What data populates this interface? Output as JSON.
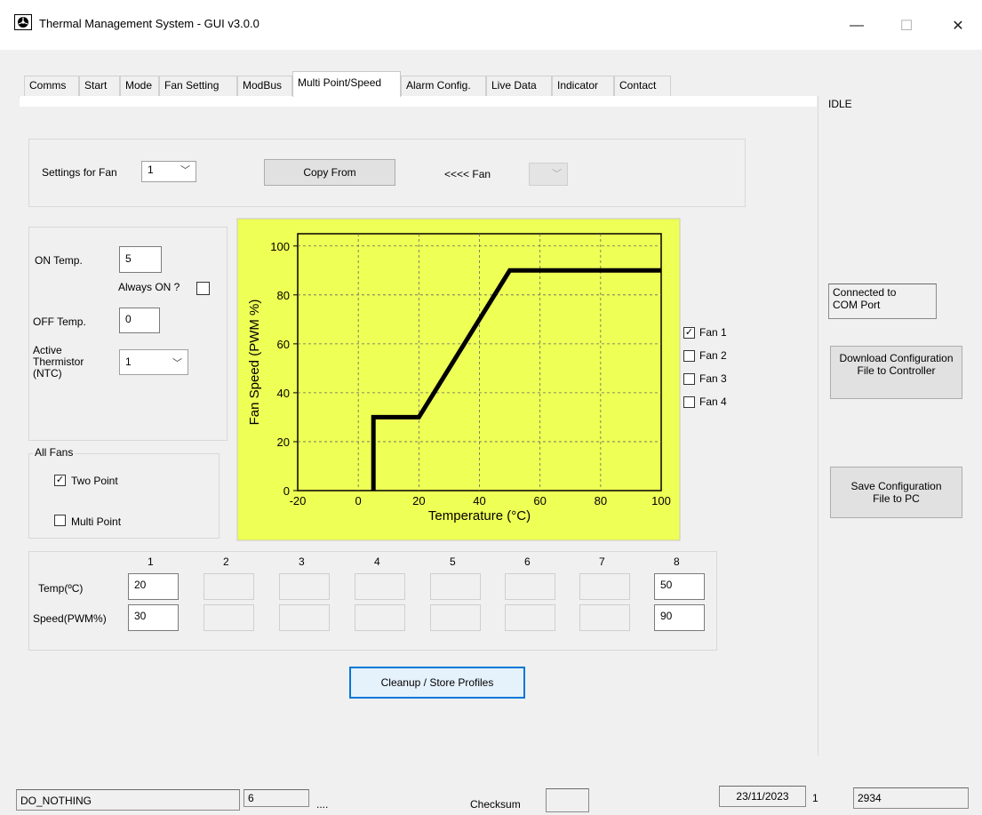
{
  "window": {
    "title": "Thermal Management System - GUI   v3.0.0",
    "minimize_glyph": "—",
    "maximize_glyph": "☐",
    "close_glyph": "✕"
  },
  "tabs": [
    "Comms",
    "Start",
    "Mode",
    "Fan Setting",
    "ModBus",
    "Multi Point/Speed",
    "Alarm Config.",
    "Live Data",
    "Indicator",
    "Contact"
  ],
  "active_tab": "Multi Point/Speed",
  "fan_select": {
    "label": "Settings for Fan",
    "value": "1",
    "copy_button": "Copy From",
    "arrow_label": "<<<<  Fan",
    "source_value": ""
  },
  "temp_settings": {
    "on_label": "ON Temp.",
    "on_value": "5",
    "always_on_label": "Always ON ?",
    "always_on_checked": false,
    "off_label": "OFF Temp.",
    "off_value": "0",
    "thermistor_label": "Active Thermistor (NTC)",
    "thermistor_value": "1"
  },
  "all_fans": {
    "title": "All Fans",
    "two_point_label": "Two Point",
    "two_point_checked": true,
    "multi_point_label": "Multi Point",
    "multi_point_checked": false
  },
  "chart_data": {
    "type": "line",
    "xlabel": "Temperature (°C)",
    "ylabel": "Fan Speed (PWM %)",
    "xlim": [
      -20,
      100
    ],
    "ylim": [
      0,
      105
    ],
    "x_ticks": [
      -20,
      0,
      20,
      40,
      60,
      80,
      100
    ],
    "y_ticks": [
      0,
      20,
      40,
      60,
      80,
      100
    ],
    "grid": true,
    "background": "#eeff55",
    "series": [
      {
        "x": [
          5,
          5,
          20,
          50,
          100
        ],
        "y": [
          0,
          30,
          30,
          90,
          90
        ]
      }
    ]
  },
  "fan_checks": [
    {
      "label": "Fan 1",
      "checked": true
    },
    {
      "label": "Fan 2",
      "checked": false
    },
    {
      "label": "Fan 3",
      "checked": false
    },
    {
      "label": "Fan 4",
      "checked": false
    }
  ],
  "points_table": {
    "columns": [
      "1",
      "2",
      "3",
      "4",
      "5",
      "6",
      "7",
      "8"
    ],
    "temp_label": "Temp(ºC)",
    "speed_label": "Speed(PWM%)",
    "temp_values": [
      "20",
      "",
      "",
      "",
      "",
      "",
      "",
      "50"
    ],
    "speed_values": [
      "30",
      "",
      "",
      "",
      "",
      "",
      "",
      "90"
    ]
  },
  "cleanup_button": "Cleanup / Store Profiles",
  "right_panel": {
    "state": "IDLE",
    "connection": "Connected to\nCOM Port",
    "download_button": "Download Configuration File to Controller",
    "save_button": "Save Configuration File to PC"
  },
  "status_bar": {
    "action": "DO_NOTHING",
    "count": "6",
    "dots": "....",
    "checksum_label": "Checksum",
    "checksum_value": "",
    "date": "23/11/2023",
    "index": "1",
    "value": "2934"
  }
}
